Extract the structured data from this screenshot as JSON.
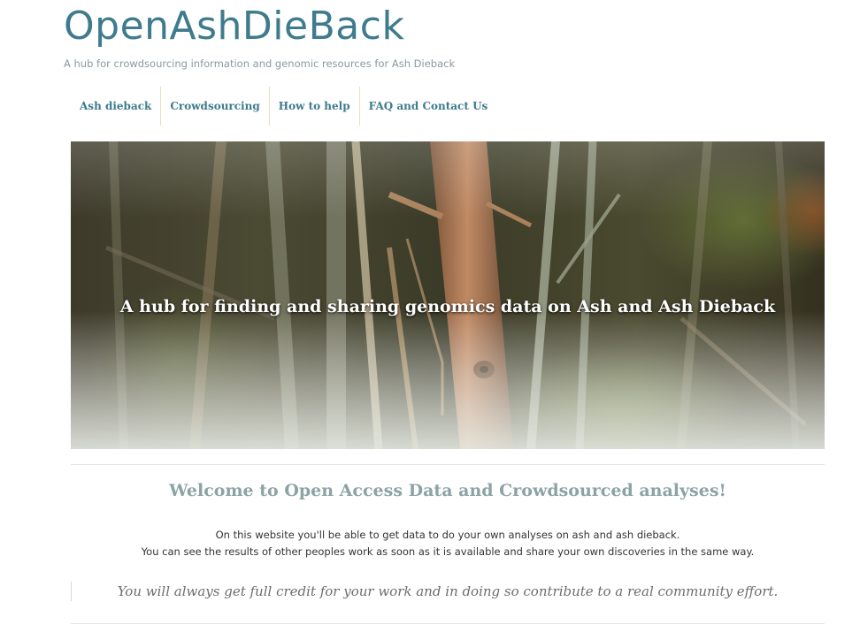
{
  "site": {
    "title": "OpenAshDieBack",
    "tagline": "A hub for crowdsourcing information and genomic resources for Ash Dieback"
  },
  "nav": {
    "items": [
      {
        "label": "Ash dieback"
      },
      {
        "label": "Crowdsourcing"
      },
      {
        "label": "How to help"
      },
      {
        "label": "FAQ and Contact Us"
      }
    ]
  },
  "hero": {
    "caption": "A hub for finding and sharing genomics data on Ash and Ash Dieback"
  },
  "content": {
    "heading": "Welcome to Open Access Data and Crowdsourced analyses!",
    "paragraph_line1": "On this website you'll be able to get data to do your own analyses on ash and ash dieback.",
    "paragraph_line2": "You can see the results of other peoples work as soon as it is available and share your own discoveries in the same way.",
    "quote": "You will always get full credit for your work and in doing so contribute to a real community effort."
  },
  "colors": {
    "accent": "#3e7b8c",
    "heading": "#8ca3a6",
    "nav_divider": "#eadfbf"
  }
}
